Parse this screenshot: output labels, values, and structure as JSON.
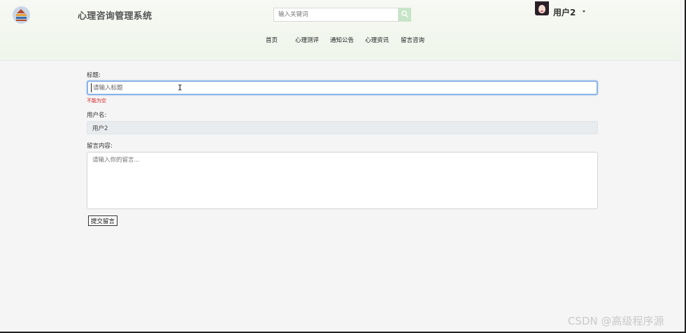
{
  "header": {
    "site_title": "心理咨询管理系统",
    "search_placeholder": "输入关键词",
    "user_name": "用户2"
  },
  "nav": {
    "items": [
      "首页",
      "心理测评",
      "通知公告",
      "心理资讯",
      "留言咨询"
    ]
  },
  "form": {
    "title_label": "标题:",
    "title_placeholder": "请输入标题",
    "title_value": "",
    "title_error": "不能为空",
    "username_label": "用户名:",
    "username_value": "用户2",
    "content_label": "留言内容:",
    "content_placeholder": "请输入你的留言...",
    "submit_label": "提交留言"
  },
  "watermark": "CSDN @高级程序源",
  "colors": {
    "header_bg": "#eff5ea",
    "focus_border": "#8ab4e8",
    "error": "#d01b1b",
    "search_button": "#c7e5c7"
  }
}
